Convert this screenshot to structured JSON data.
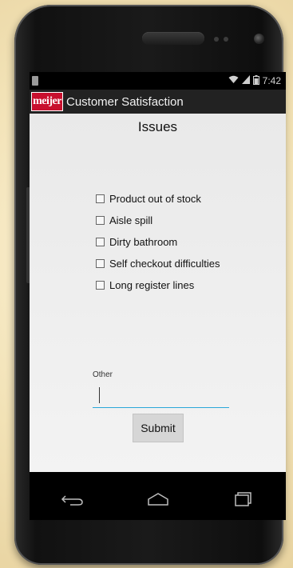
{
  "status_bar": {
    "time": "7:42",
    "wifi_icon": "wifi-icon",
    "signal_icon": "signal-icon",
    "battery_icon": "battery-icon"
  },
  "action_bar": {
    "logo_text": "meijer",
    "title": "Customer Satisfaction"
  },
  "page": {
    "title": "Issues",
    "checkboxes": [
      {
        "label": "Product out of stock",
        "checked": false
      },
      {
        "label": "Aisle spill",
        "checked": false
      },
      {
        "label": "Dirty bathroom",
        "checked": false
      },
      {
        "label": "Self checkout difficulties",
        "checked": false
      },
      {
        "label": "Long register lines",
        "checked": false
      }
    ],
    "other_label": "Other",
    "other_value": "",
    "submit_label": "Submit"
  },
  "nav_bar": {
    "back_icon": "back-icon",
    "home_icon": "home-icon",
    "recents_icon": "recent-apps-icon"
  },
  "colors": {
    "accent": "#2aa7d9",
    "action_bar": "#222222",
    "logo_red": "#c8102e"
  }
}
